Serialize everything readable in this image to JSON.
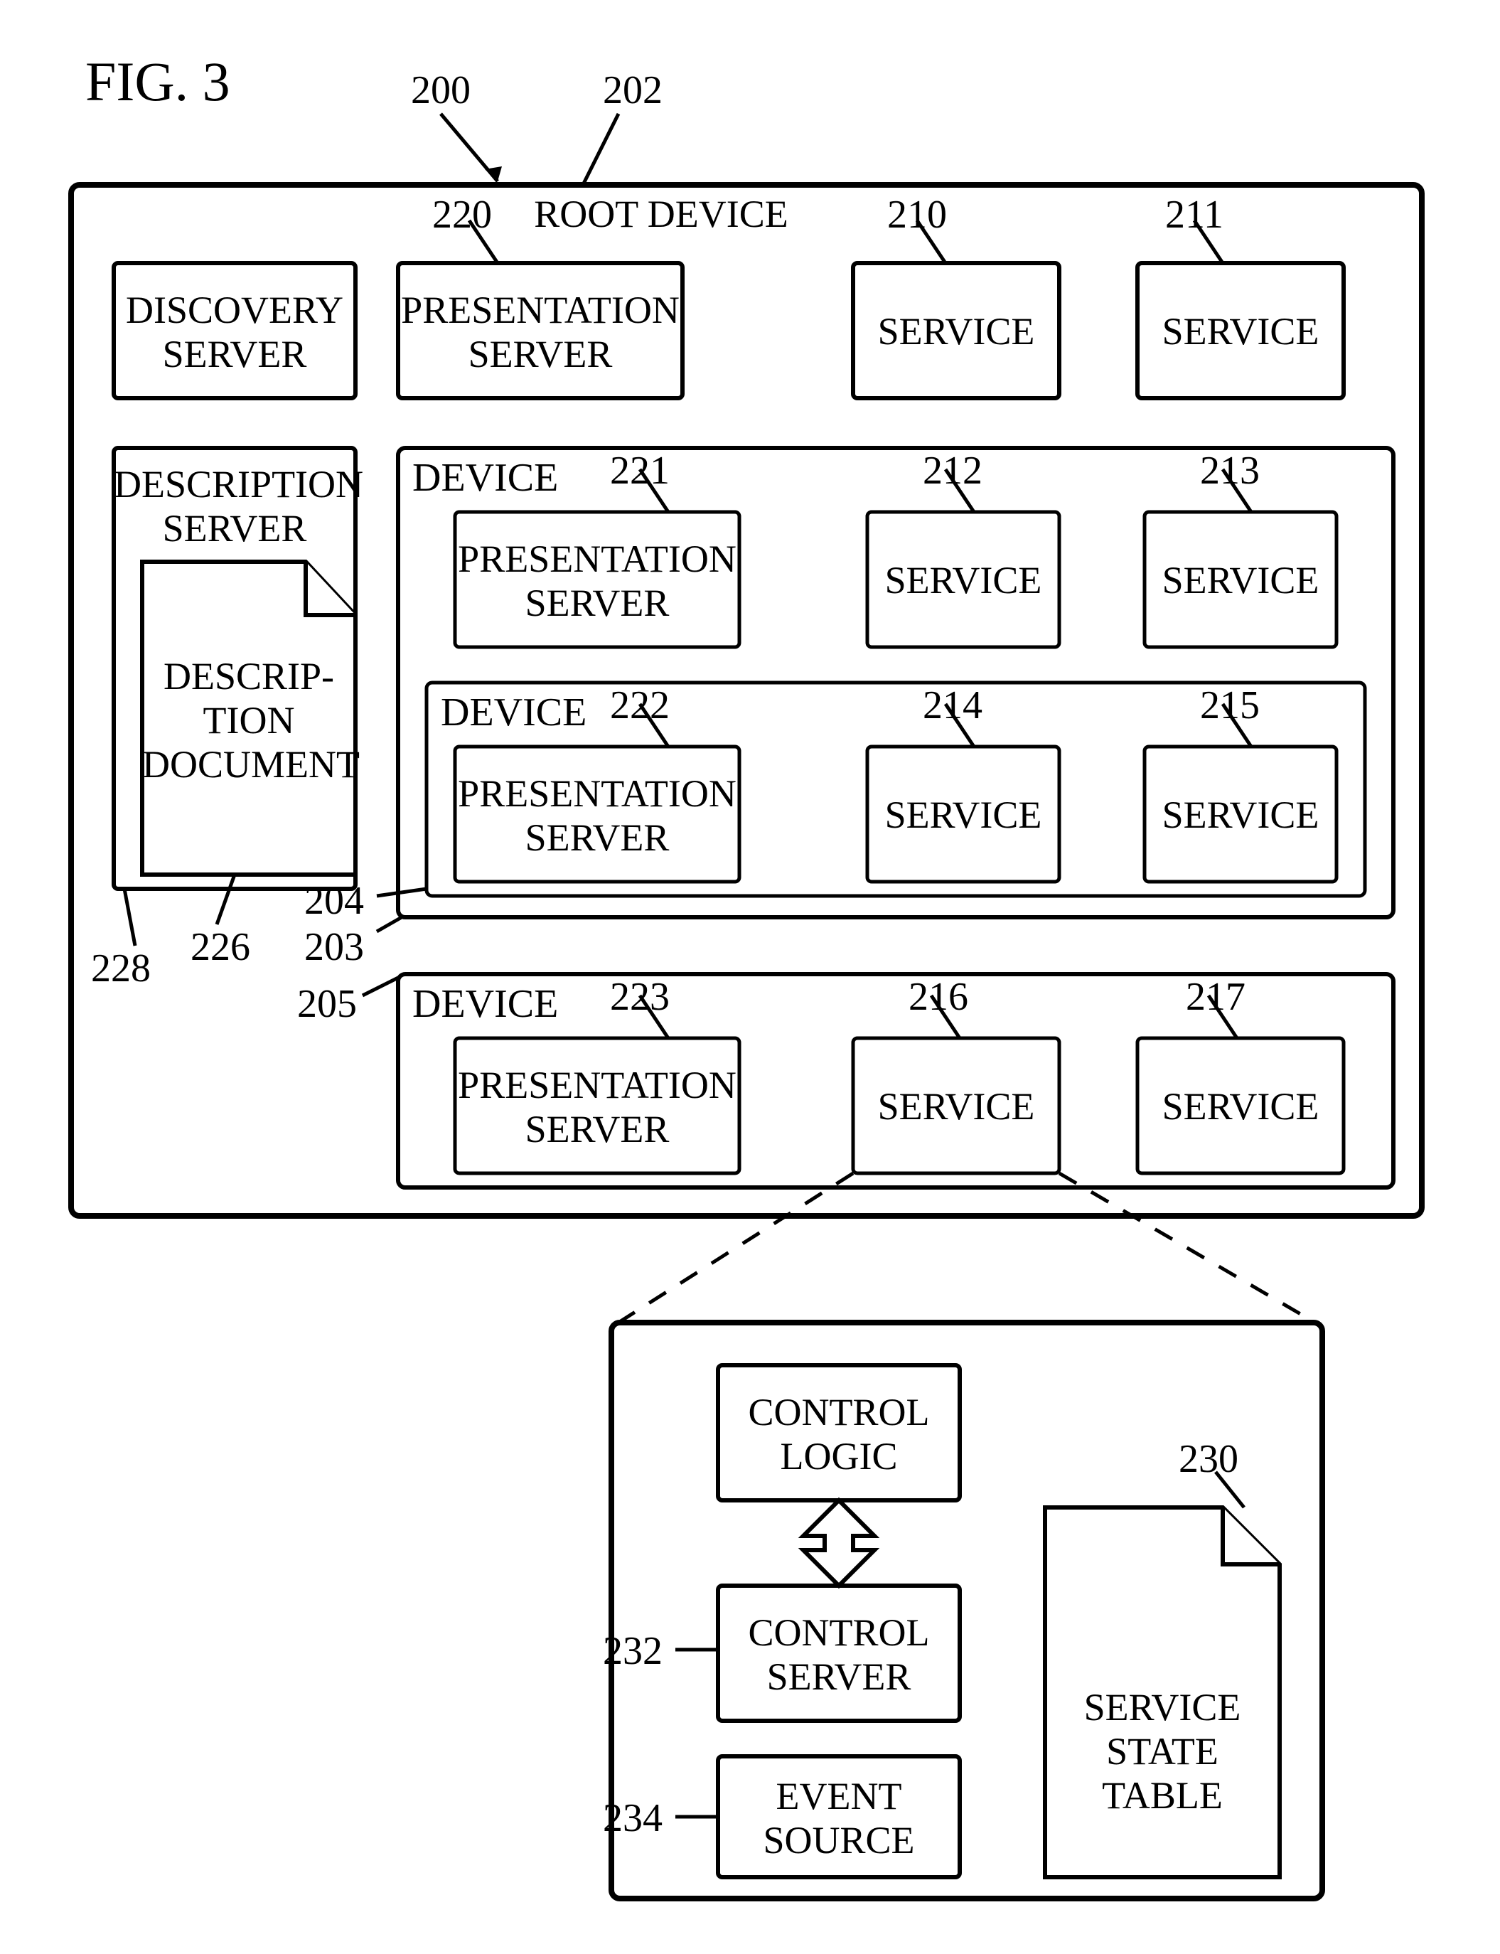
{
  "figure": {
    "label": "FIG. 3"
  },
  "refs": {
    "r200": "200",
    "r202": "202",
    "r220": "220",
    "r210": "210",
    "r211": "211",
    "r221": "221",
    "r212": "212",
    "r213": "213",
    "r222": "222",
    "r214": "214",
    "r215": "215",
    "r223": "223",
    "r216": "216",
    "r217": "217",
    "r203": "203",
    "r204": "204",
    "r205": "205",
    "r226": "226",
    "r228": "228",
    "r230": "230",
    "r232": "232",
    "r234": "234"
  },
  "nodes": {
    "root_device": "ROOT DEVICE",
    "discovery_server": "DISCOVERY\nSERVER",
    "presentation_server": "PRESENTATION\nSERVER",
    "service": "SERVICE",
    "description_server": "DESCRIPTION\nSERVER",
    "description_document": "DESCRIP-\nTION\nDOCUMENT",
    "device": "DEVICE",
    "control_logic": "CONTROL\nLOGIC",
    "control_server": "CONTROL\nSERVER",
    "event_source": "EVENT\nSOURCE",
    "service_state_table": "SERVICE\nSTATE\nTABLE"
  }
}
